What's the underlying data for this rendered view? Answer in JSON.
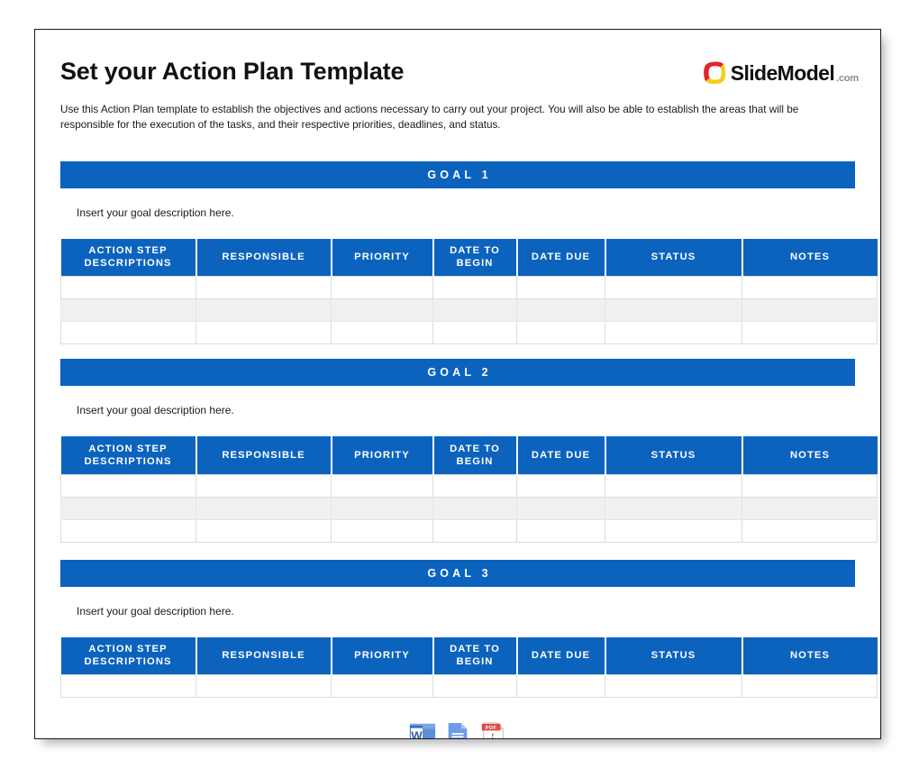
{
  "document": {
    "title": "Set your Action Plan Template",
    "intro": "Use this Action Plan template to establish the objectives and actions necessary to carry out your project. You will also be able to establish the areas that will be responsible for the execution of the tasks, and their respective priorities, deadlines, and status."
  },
  "brand": {
    "name": "SlideModel",
    "tld": ".com",
    "mark_icon": "slidemodel-logo-icon",
    "color_red": "#E2242B",
    "color_yellow": "#F5CE1A"
  },
  "theme": {
    "accent_blue": "#0C63BE",
    "row_alt_gray": "#f0f0f0",
    "border_gray": "#dcdcdc",
    "page_border": "#1a1a1a"
  },
  "table_headers": [
    "ACTION STEP DESCRIPTIONS",
    "RESPONSIBLE",
    "PRIORITY",
    "DATE TO BEGIN",
    "DATE DUE",
    "STATUS",
    "NOTES"
  ],
  "goals": [
    {
      "bar_label": "GOAL 1",
      "description": "Insert your goal description here.",
      "rows": [
        "",
        "",
        ""
      ]
    },
    {
      "bar_label": "GOAL 2",
      "description": "Insert your goal description here.",
      "rows": [
        "",
        "",
        ""
      ]
    },
    {
      "bar_label": "GOAL 3",
      "description": "Insert your goal description here.",
      "rows": [
        ""
      ]
    }
  ],
  "footer": {
    "downloads": [
      {
        "icon": "word-file-icon",
        "label": "Word"
      },
      {
        "icon": "google-docs-file-icon",
        "label": "Google Docs"
      },
      {
        "icon": "pdf-file-icon",
        "label": "PDF"
      }
    ]
  }
}
